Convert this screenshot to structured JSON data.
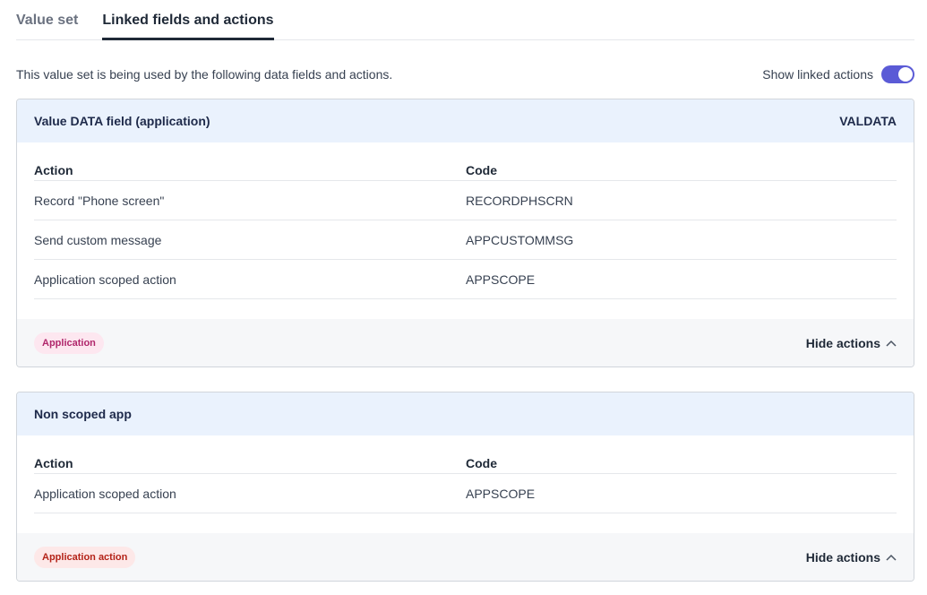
{
  "tabs": [
    {
      "label": "Value set",
      "active": false
    },
    {
      "label": "Linked fields and actions",
      "active": true
    }
  ],
  "intro": {
    "text": "This value set is being used by the following data fields and actions.",
    "toggle_label": "Show linked actions",
    "toggle_on": true
  },
  "cards": [
    {
      "title": "Value DATA field (application)",
      "code": "VALDATA",
      "columns": {
        "action": "Action",
        "code": "Code"
      },
      "rows": [
        {
          "action": "Record \"Phone screen\"",
          "code": "RECORDPHSCRN"
        },
        {
          "action": "Send custom message",
          "code": "APPCUSTOMMSG"
        },
        {
          "action": "Application scoped action",
          "code": "APPSCOPE"
        }
      ],
      "badge": "Application",
      "hide_label": "Hide actions"
    },
    {
      "title": "Non scoped app",
      "code": "",
      "columns": {
        "action": "Action",
        "code": "Code"
      },
      "rows": [
        {
          "action": "Application scoped action",
          "code": "APPSCOPE"
        }
      ],
      "badge": "Application action",
      "hide_label": "Hide actions"
    }
  ],
  "colors": {
    "accent": "#5b5bd6",
    "header_bg": "#eaf2fd",
    "badge_pink": "#b0266b",
    "badge_red": "#b42318"
  }
}
